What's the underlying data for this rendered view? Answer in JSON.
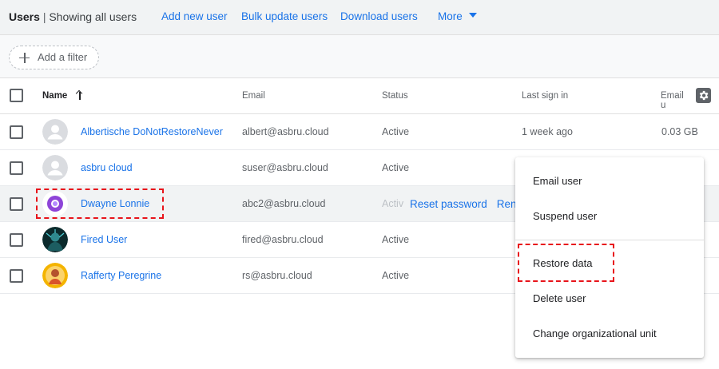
{
  "header": {
    "title": "Users",
    "separator": "|",
    "subtitle": "Showing all users",
    "links": [
      "Add new user",
      "Bulk update users",
      "Download users"
    ],
    "more_label": "More"
  },
  "filter": {
    "add_filter_label": "Add a filter"
  },
  "table": {
    "columns": [
      "Name",
      "Email",
      "Status",
      "Last sign in",
      "Email u"
    ],
    "sort": {
      "column": "Name",
      "direction": "ascending"
    },
    "rows": [
      {
        "name": "Albertische DoNotRestoreNever",
        "email": "albert@asbru.cloud",
        "status": "Active",
        "last_sign_in": "1 week ago",
        "email_usage": "0.03 GB",
        "avatar": "default-person-icon"
      },
      {
        "name": "asbru cloud",
        "email": "suser@asbru.cloud",
        "status": "Active",
        "last_sign_in": "",
        "email_usage": "",
        "avatar": "default-person-icon"
      },
      {
        "name": "Dwayne Lonnie",
        "email": "abc2@asbru.cloud",
        "status": "Activ",
        "last_sign_in": "",
        "email_usage": "",
        "avatar": "purple-circle-avatar",
        "hover_actions": [
          "Reset password",
          "Rena"
        ]
      },
      {
        "name": "Fired User",
        "email": "fired@asbru.cloud",
        "status": "Active",
        "last_sign_in": "",
        "email_usage": "",
        "avatar": "dark-photo-avatar"
      },
      {
        "name": "Rafferty Peregrine",
        "email": "rs@asbru.cloud",
        "status": "Active",
        "last_sign_in": "",
        "email_usage": "",
        "avatar": "orange-photo-avatar"
      }
    ]
  },
  "context_menu": {
    "items": [
      "Email user",
      "Suspend user",
      "Restore data",
      "Delete user",
      "Change organizational unit"
    ]
  },
  "colors": {
    "link": "#1a73e8",
    "annotation": "#e8141b",
    "header_bg": "#f1f3f4"
  }
}
